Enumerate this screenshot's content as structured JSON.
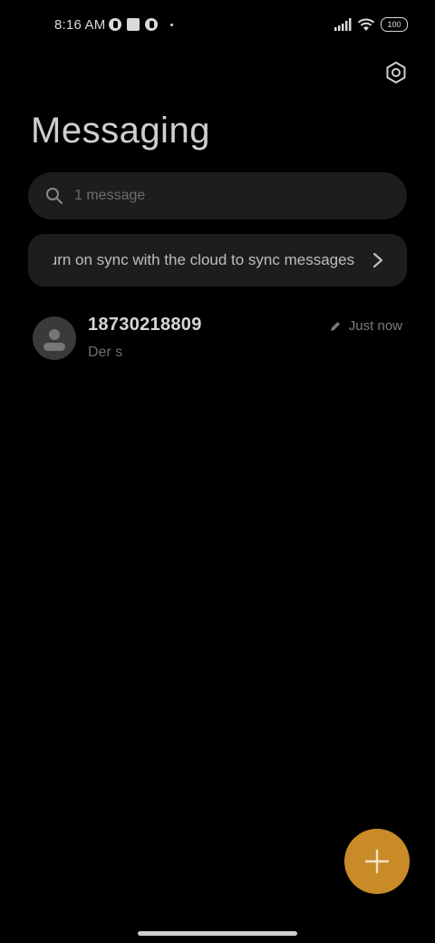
{
  "status_bar": {
    "time": "8:16 AM",
    "battery": "100",
    "left_icons": [
      "app-notification-icon",
      "square-notification-icon",
      "app-notification-icon",
      "dot-icon"
    ],
    "right_icons": [
      "signal-icon",
      "wifi-icon",
      "battery-icon"
    ]
  },
  "header": {
    "title": "Messaging",
    "settings_icon": "settings-hex-icon"
  },
  "search": {
    "placeholder": "1 message"
  },
  "sync_banner": {
    "text": "Turn on sync with the cloud to sync messages"
  },
  "conversations": [
    {
      "name": "18730218809",
      "preview": "Der s",
      "timestamp": "Just now",
      "status_icon": "draft-pencil-icon"
    }
  ],
  "fab": {
    "icon": "plus-icon",
    "color": "#c98b28"
  },
  "colors": {
    "background": "#000000",
    "surface": "#1d1d1d",
    "accent": "#c98b28"
  }
}
